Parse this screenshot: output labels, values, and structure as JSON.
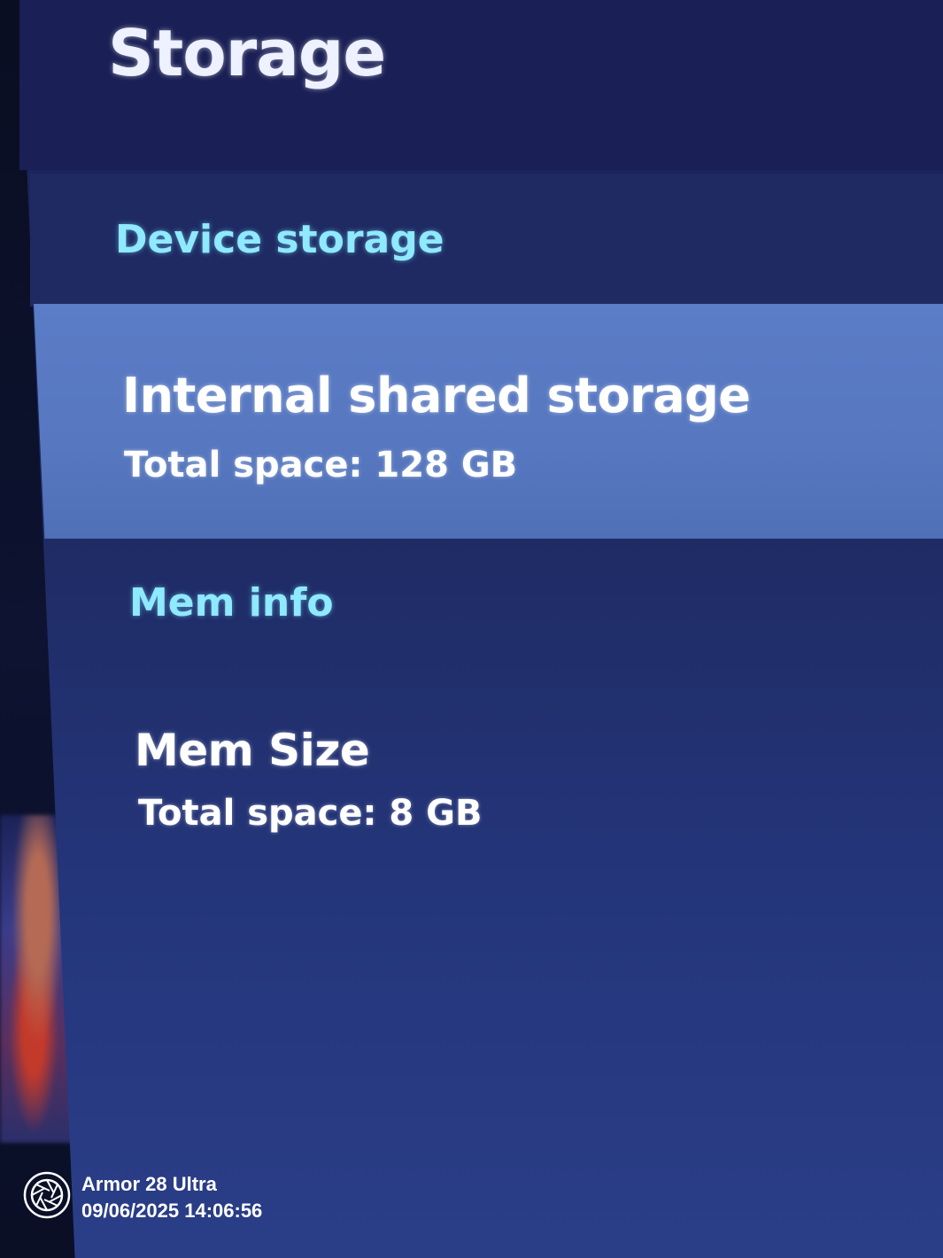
{
  "header": {
    "title": "Storage"
  },
  "sections": [
    {
      "header": "Device storage",
      "items": [
        {
          "title": "Internal shared storage",
          "subtitle": "Total space: 128 GB",
          "selected": true
        }
      ]
    },
    {
      "header": "Mem info",
      "items": [
        {
          "title": "Mem Size",
          "subtitle": "Total space: 8 GB",
          "selected": false
        }
      ]
    }
  ],
  "watermark": {
    "device": "Armor 28 Ultra",
    "timestamp": "09/06/2025 14:06:56",
    "icon": "camera-shutter-icon"
  },
  "colors": {
    "panel": "#1e2a62",
    "selected_item": "#5778c0",
    "section_header": "#8fe9ff",
    "text": "#ffffff"
  }
}
